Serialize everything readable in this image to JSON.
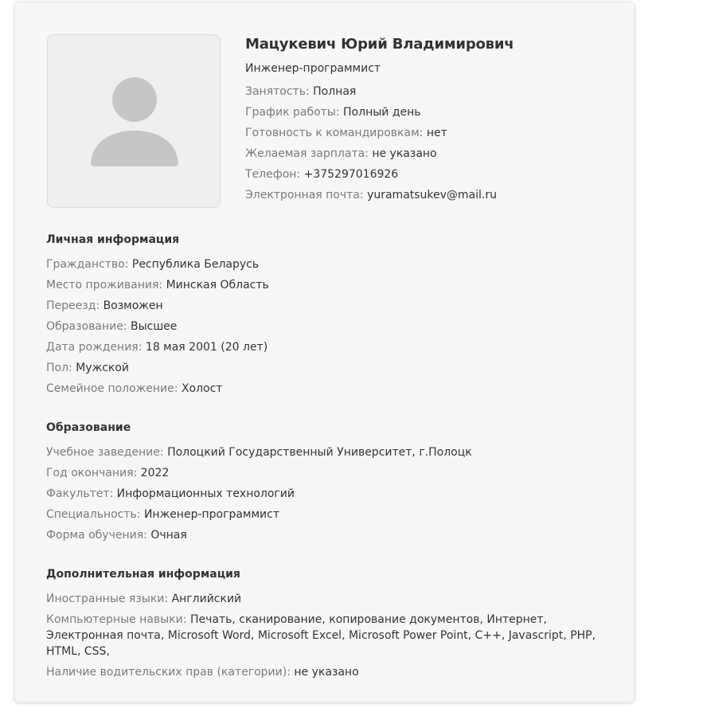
{
  "profile": {
    "name": "Мацукевич Юрий Владимирович",
    "position": "Инженер-программист",
    "avatar_icon": "user-placeholder-icon",
    "fields": [
      {
        "label": "Занятость:",
        "value": "Полная"
      },
      {
        "label": "График работы:",
        "value": "Полный день"
      },
      {
        "label": "Готовность к командировкам:",
        "value": "нет"
      },
      {
        "label": "Желаемая зарплата:",
        "value": "не указано"
      },
      {
        "label": "Телефон:",
        "value": "+375297016926"
      },
      {
        "label": "Электронная почта:",
        "value": "yuramatsukev@mail.ru"
      }
    ]
  },
  "personal": {
    "title": "Личная информация",
    "fields": [
      {
        "label": "Гражданство:",
        "value": "Республика Беларусь"
      },
      {
        "label": "Место проживания:",
        "value": "Минская Область"
      },
      {
        "label": "Переезд:",
        "value": "Возможен"
      },
      {
        "label": "Образование:",
        "value": "Высшее"
      },
      {
        "label": "Дата рождения:",
        "value": "18 мая 2001 (20 лет)"
      },
      {
        "label": "Пол:",
        "value": "Мужской"
      },
      {
        "label": "Семейное положение:",
        "value": "Холост"
      }
    ]
  },
  "education": {
    "title": "Образование",
    "fields": [
      {
        "label": "Учебное заведение:",
        "value": "Полоцкий Государственный Университет, г.Полоцк"
      },
      {
        "label": "Год окончания:",
        "value": "2022"
      },
      {
        "label": "Факультет:",
        "value": "Информационных технологий"
      },
      {
        "label": "Специальность:",
        "value": "Инженер-программист"
      },
      {
        "label": "Форма обучения:",
        "value": "Очная"
      }
    ]
  },
  "additional": {
    "title": "Дополнительная информация",
    "fields": [
      {
        "label": "Иностранные языки:",
        "value": "Английский"
      },
      {
        "label": "Компьютерные навыки:",
        "value": "Печать, сканирование, копирование документов, Интернет, Электронная почта, Microsoft Word, Microsoft Excel, Microsoft Power Point, C++, Javascript, PHP, HTML, CSS,"
      },
      {
        "label": "Наличие водительских прав (категории):",
        "value": "не указано"
      }
    ]
  },
  "colors": {
    "card_bg": "#f7f7f8",
    "label": "#7a7a7a",
    "value": "#333333",
    "avatar_fill": "#c6c6c6"
  }
}
